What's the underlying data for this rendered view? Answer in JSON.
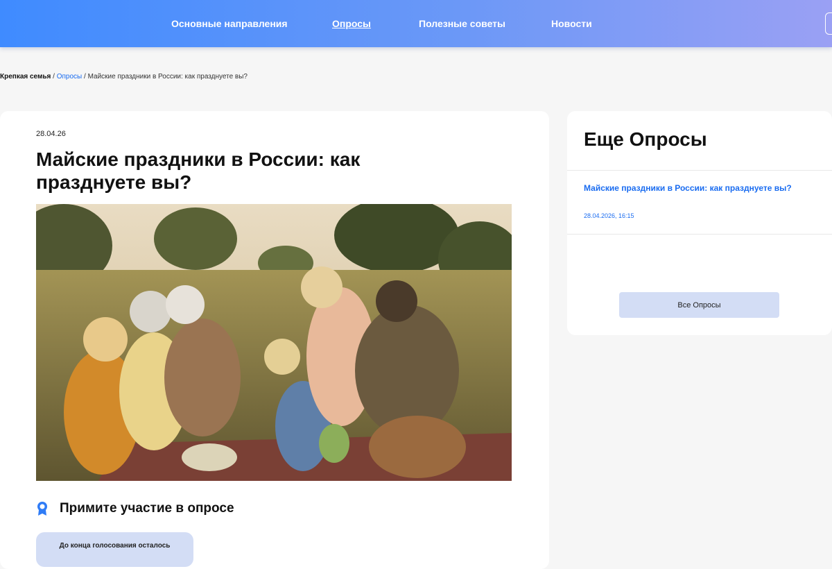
{
  "header": {
    "nav": [
      {
        "label": "Основные направления",
        "active": false
      },
      {
        "label": "Опросы",
        "active": true
      },
      {
        "label": "Полезные советы",
        "active": false
      },
      {
        "label": "Новости",
        "active": false
      }
    ],
    "colors": {
      "gradient_start": "#3f8bff",
      "gradient_end": "#9aa0f4"
    }
  },
  "breadcrumb": {
    "root": "Крепкая семья",
    "separator": " / ",
    "section": "Опросы",
    "current": "Майские праздники в России: как празднуете вы?"
  },
  "article": {
    "date": "28.04.26",
    "title": "Майские праздники в России: как празднуете вы?",
    "image_icon": "family-picnic-photo",
    "poll_heading": "Примите участие в опросе",
    "poll_icon": "medal-icon",
    "timer_label": "До конца голосования осталось"
  },
  "sidebar": {
    "title": "Еще Опросы",
    "polls": [
      {
        "title": "Майские праздники в России: как празднуете вы?",
        "date": "28.04.2026, 16:15"
      }
    ],
    "all_button": "Все Опросы"
  },
  "colors": {
    "accent": "#1a6cf0",
    "soft_button": "#d3ddf5",
    "page_bg": "#f6f6f6"
  }
}
